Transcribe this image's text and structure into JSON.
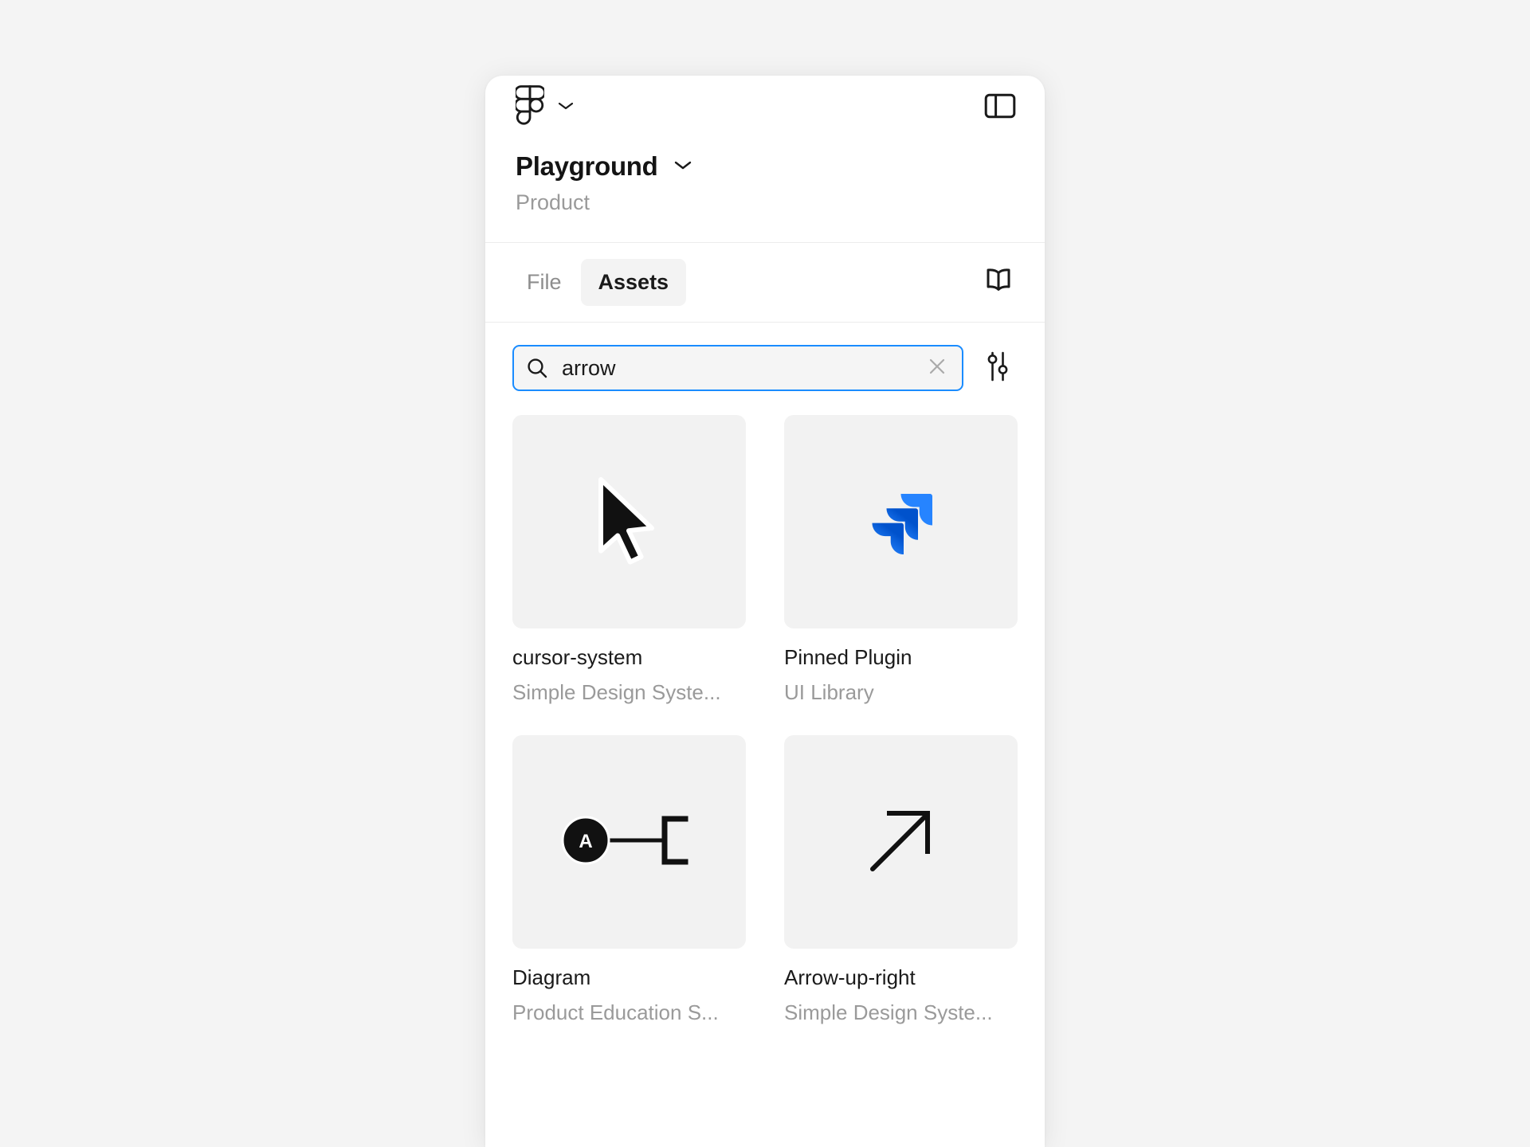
{
  "app": {
    "name": "Figma",
    "logo_icon": "figma-logo-icon",
    "menu_chevron_icon": "chevron-down-icon",
    "sidebar_toggle_icon": "panel-left-icon"
  },
  "colors": {
    "page_background": "#f4f4f4",
    "panel_background": "#ffffff",
    "thumbnail_background": "#f2f2f2",
    "focus_accent": "#1a8cff",
    "active_tab_background": "#f3f3f3",
    "text_primary": "#1a1a1a",
    "text_muted": "#9a9a9a",
    "divider": "#ececec",
    "jira_blue": "#2684ff",
    "node_fill": "#111111"
  },
  "file": {
    "title": "Playground",
    "title_chevron_icon": "chevron-down-icon",
    "subtitle": "Product"
  },
  "tabs": {
    "items": [
      {
        "label": "File",
        "active": false,
        "name": "tab-file"
      },
      {
        "label": "Assets",
        "active": true,
        "name": "tab-assets"
      }
    ],
    "library_icon": "book-open-icon"
  },
  "search": {
    "value": "arrow",
    "placeholder": "Search",
    "icon": "search-icon",
    "clear_icon": "close-icon",
    "focused": true,
    "filter_icon": "sliders-icon"
  },
  "assets": [
    {
      "name": "cursor-system",
      "library": "Simple Design Syste...",
      "thumbnail_icon": "mouse-cursor-icon"
    },
    {
      "name": "Pinned Plugin",
      "library": "UI Library",
      "thumbnail_icon": "jira-logo-icon"
    },
    {
      "name": "Diagram",
      "library": "Product Education S...",
      "thumbnail_icon": "node-connector-icon",
      "node_label": "A"
    },
    {
      "name": "Arrow-up-right",
      "library": "Simple Design Syste...",
      "thumbnail_icon": "arrow-up-right-icon"
    }
  ]
}
